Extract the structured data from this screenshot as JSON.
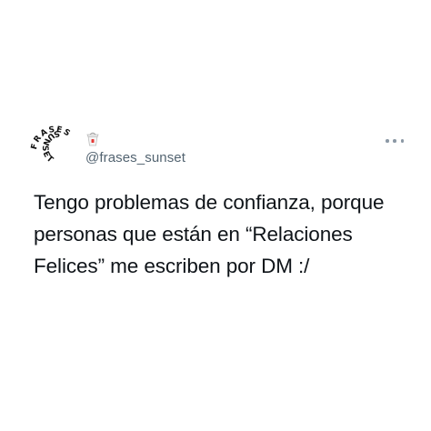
{
  "tweet": {
    "avatar": {
      "logo_text_top": "FRASES",
      "logo_text_bottom": "SUNSET",
      "icon": "takeout-box-emoji-icon"
    },
    "handle": "@frases_sunset",
    "more_icon": "more-horizontal-icon",
    "text_lines": [
      "Tengo problemas de confianza, porque",
      "personas que están en “Relaciones",
      "Felices” me escriben por DM :/"
    ]
  },
  "colors": {
    "background": "#ffffff",
    "text": "#0f1419",
    "handle": "#536471",
    "more_dots": "#8b98a5"
  }
}
